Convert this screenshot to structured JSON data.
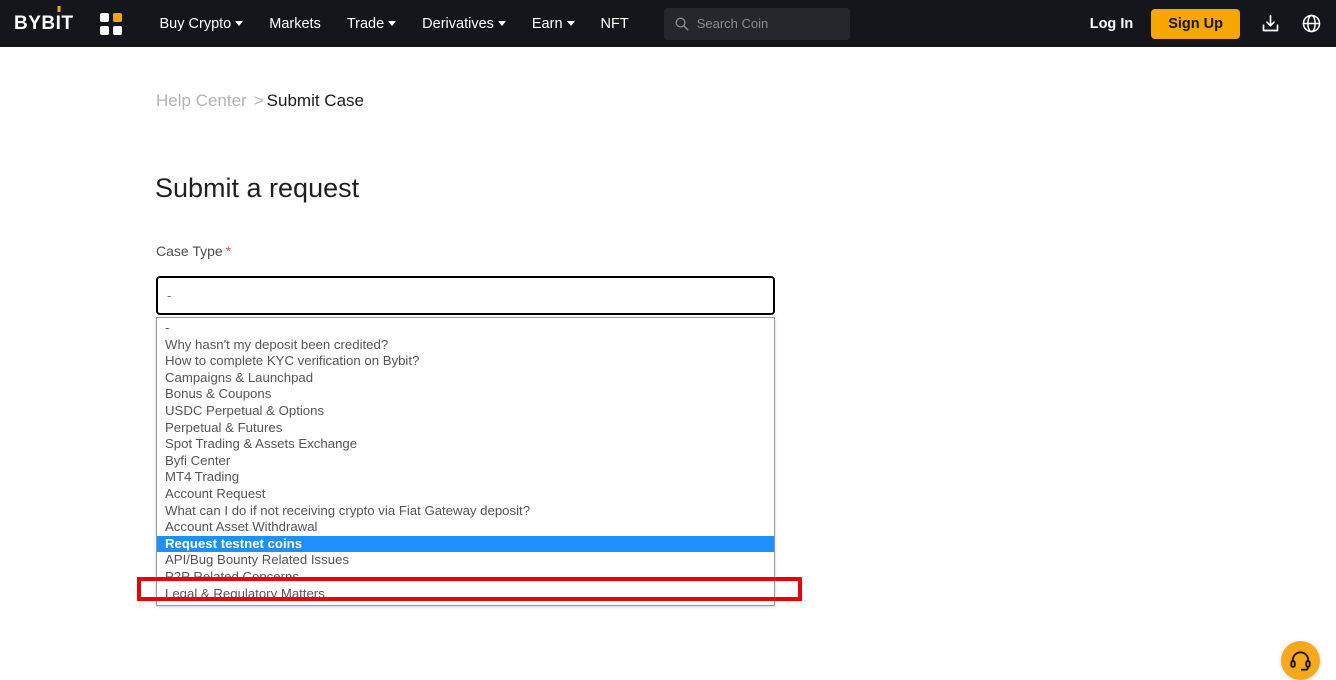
{
  "nav": {
    "logo_text_a": "BYB",
    "logo_text_i": "I",
    "logo_text_t": "T",
    "grid_icon": "apps-grid-icon",
    "items": [
      {
        "label": "Buy Crypto",
        "has_caret": true
      },
      {
        "label": "Markets",
        "has_caret": false
      },
      {
        "label": "Trade",
        "has_caret": true
      },
      {
        "label": "Derivatives",
        "has_caret": true
      },
      {
        "label": "Earn",
        "has_caret": true
      },
      {
        "label": "NFT",
        "has_caret": false
      }
    ],
    "search": {
      "placeholder": "Search Coin",
      "value": "",
      "icon": "search-icon"
    },
    "login_label": "Log In",
    "signup_label": "Sign Up",
    "download_icon": "download-icon",
    "language_icon": "globe-icon"
  },
  "breadcrumb": {
    "root": "Help Center",
    "separator": ">",
    "current": "Submit Case"
  },
  "main": {
    "title": "Submit a request",
    "case_type": {
      "label": "Case Type",
      "required_marker": "*",
      "input_value": "-",
      "options": [
        "-",
        "Why hasn't my deposit been credited?",
        "How to complete KYC verification on Bybit?",
        "Campaigns & Launchpad",
        "Bonus & Coupons",
        "USDC Perpetual & Options",
        "Perpetual & Futures",
        "Spot Trading & Assets Exchange",
        "Byfi Center",
        "MT4 Trading",
        "Account Request",
        "What can I do if not receiving crypto via Fiat Gateway deposit?",
        "Account Asset Withdrawal",
        "Request testnet coins",
        "API/Bug Bounty Related Issues",
        "P2P Related Concerns",
        "Legal & Regulatory Matters"
      ],
      "selected_option": "Request testnet coins",
      "selected_index": 13
    }
  },
  "support": {
    "icon": "headset-icon"
  },
  "colors": {
    "nav_background": "#15161a",
    "brand_accent": "#f7a600",
    "selection_blue": "#1e90ff",
    "annotation_red": "#e60000",
    "required_red": "#e8544f"
  }
}
